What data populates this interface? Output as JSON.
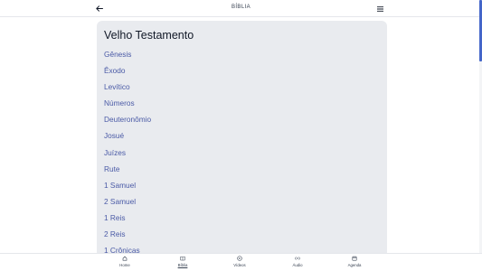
{
  "header": {
    "title": "BÍBLIA",
    "back_icon": "arrow-left-icon",
    "menu_icon": "hamburger-menu-icon"
  },
  "section": {
    "title": "Velho Testamento",
    "books": [
      "Gênesis",
      "Êxodo",
      "Levítico",
      "Números",
      "Deuteronômio",
      "Josué",
      "Juízes",
      "Rute",
      "1 Samuel",
      "2 Samuel",
      "1 Reis",
      "2 Reis",
      "1 Crônicas"
    ]
  },
  "bottom_nav": {
    "items": [
      {
        "label": "Home",
        "icon": "home-icon"
      },
      {
        "label": "Bíblia",
        "icon": "book-icon",
        "active": true
      },
      {
        "label": "Vídeos",
        "icon": "play-icon"
      },
      {
        "label": "Áudio",
        "icon": "radio-icon"
      },
      {
        "label": "Agenda",
        "icon": "calendar-icon"
      }
    ]
  },
  "colors": {
    "accent": "#4466c9",
    "link": "#4a5aa6",
    "card_bg": "#e9ebef"
  }
}
